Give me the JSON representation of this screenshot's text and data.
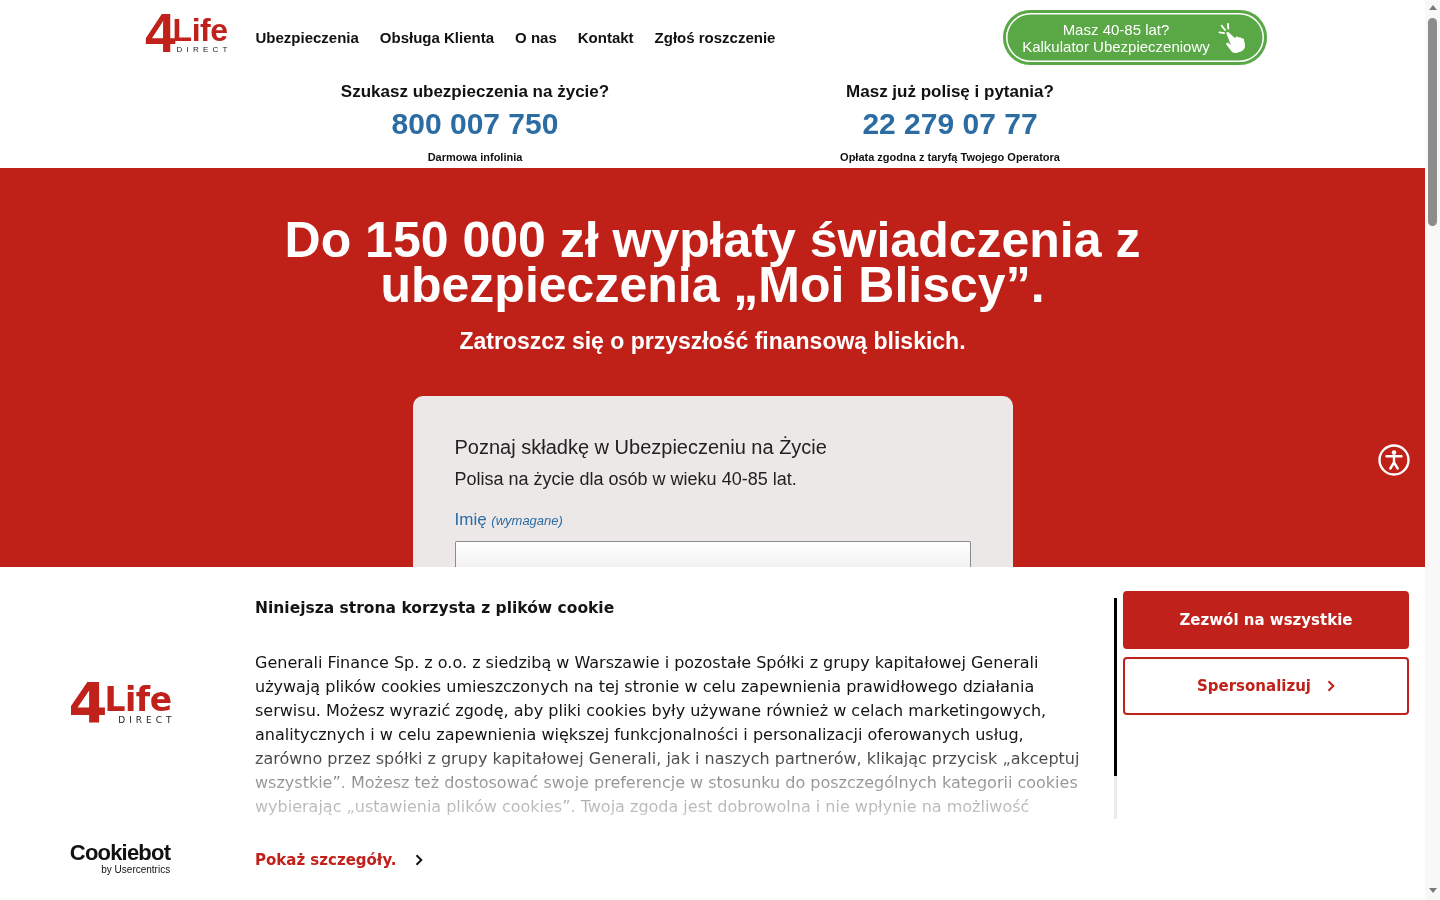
{
  "header": {
    "logo": {
      "mark": "4",
      "name": "Life",
      "sub": "DIRECT"
    },
    "nav": [
      "Ubezpieczenia",
      "Obsługa Klienta",
      "O nas",
      "Kontakt",
      "Zgłoś roszczenie"
    ],
    "cta_button": {
      "lines": [
        "Masz 40-85 lat?",
        "Kalkulator Ubezpieczeniowy"
      ]
    }
  },
  "contacts": [
    {
      "title": "Szukasz ubezpieczenia na życie?",
      "phone": "800 007 750",
      "note": "Darmowa infolinia"
    },
    {
      "title": "Masz już polisę i pytania?",
      "phone": "22 279 07 77",
      "note": "Opłata zgodna z taryfą Twojego Operatora"
    }
  ],
  "hero": {
    "title": "Do 150 000 zł wypłaty świadczenia z ubezpieczenia „Moi Bliscy”.",
    "subtitle": "Zatroszcz się o przyszłość finansową bliskich."
  },
  "form": {
    "title": "Poznaj składkę w Ubezpieczeniu na Życie",
    "subtitle": "Polisa na życie dla osób w wieku 40-85 lat.",
    "fields": [
      {
        "label": "Imię",
        "required_note": "(wymagane)"
      }
    ]
  },
  "cookie_banner": {
    "logo": {
      "mark": "4",
      "name": "Life",
      "sub": "DIRECT"
    },
    "title": "Niniejsza strona korzysta z plików cookie",
    "text": "Generali Finance Sp. z o.o. z siedzibą w Warszawie i pozostałe Spółki z grupy kapitałowej Generali używają plików cookies umieszczonych na tej stronie w celu zapewnienia prawidłowego działania serwisu. Możesz wyrazić zgodę, aby pliki cookies były używane również w celach marketingowych, analitycznych i w celu zapewnienia większej funkcjonalności i personalizacji oferowanych usług, zarówno przez spółki z grupy kapitałowej Generali, jak i naszych partnerów, klikając przycisk „akceptuj wszystkie”. Możesz też dostosować swoje preferencje w stosunku do poszczególnych kategorii cookies wybierając „ustawienia plików cookies”. Twoja zgoda jest dobrowolna i nie wpłynie na możliwość",
    "details_link": "Pokaż szczegóły.",
    "buttons": [
      {
        "label": "Zezwól na wszystkie",
        "kind": "primary"
      },
      {
        "label": "Spersonalizuj",
        "kind": "secondary"
      }
    ],
    "powered_by": {
      "name": "Cookiebot",
      "sub": "by Usercentrics"
    }
  }
}
